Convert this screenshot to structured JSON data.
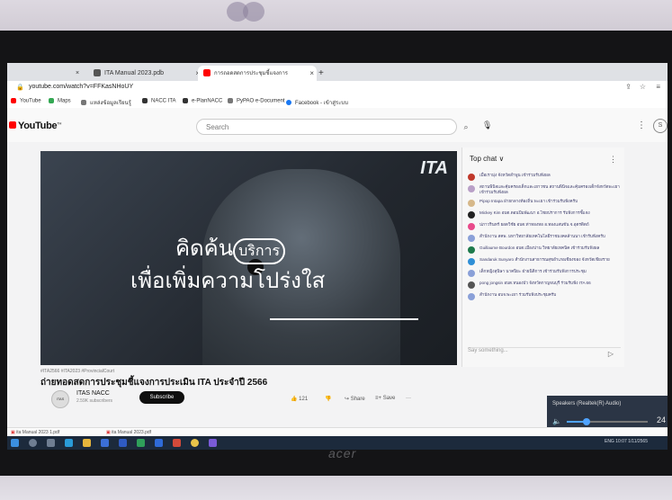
{
  "browser": {
    "tabs": [
      {
        "label": "×"
      },
      {
        "label": "ITA Manual 2023.pdb"
      },
      {
        "label": "การถอดสดการประชุมชี้แจงการ"
      }
    ],
    "new_tab": "+",
    "url": "youtube.com/watch?v=FFKasNHoUY",
    "bookmarks": [
      "YouTube",
      "Maps",
      "แหล่งข้อมูลเรียนรู้",
      "NACC ITA",
      "e-PlanNACC",
      "PyPAO e-Document",
      "Facebook - เข้าสู่ระบบ"
    ]
  },
  "youtube": {
    "logo": "YouTube",
    "logo_sup": "TH",
    "search_placeholder": "Search",
    "search_icon": "search-icon",
    "avatar_initial": "S"
  },
  "video": {
    "brand": "ITA",
    "overlay_line1": "คิดค้น",
    "overlay_bubble": "บริการ",
    "overlay_line2": "เพื่อเพิ่มความโปร่งใส"
  },
  "chat": {
    "header": "Top chat ∨",
    "menu": "⋮",
    "messages": [
      {
        "text": "เมื่อเรามุ่ง จังหวัดลำพูน เข้าร่วมรับฟังผล",
        "color": "#c0392b"
      },
      {
        "text": "สถานพินิจและคุ้มครองเด็กและเยาวชน สถานพินิจและคุ้มครองเด็กจังหวัดพะเยา เข้าร่วมรับฟังผล",
        "color": "#b9a0c7"
      },
      {
        "text": "Pipop Intapa ฝ่ายกลางท้องถิ่น พะเยา เข้าร่วมรับฟังครับ",
        "color": "#d6b88a"
      },
      {
        "text": "Mickey Kim อบต.ดอนปีมพัฒนา อ.ไชยปราการ รับฟังการชี้แจง",
        "color": "#222222"
      },
      {
        "text": "ปภาวรินทร์ ยอดวิชัย อบต.ท่าทองหอ อ.ทองแสนขัน จ.อุตรดิตถ์",
        "color": "#e84a8a"
      },
      {
        "text": "สำนักงาน สคพ. มหาวิทยาลัยเทคโนโลยีราชมงคลล้านนา เข้ารับฟังครับ",
        "color": "#8aa0d8"
      },
      {
        "text": "Guillaume Bourdon อบต.เมืองปาน วิทยาลัยเทคนิค เข้าร่วมรับฟังผล",
        "color": "#1e7a4c"
      },
      {
        "text": "Sandaruk Sunyaro สำนักงานสาธารณสุขอำเภอเชียงของ จังหวัดเชียงราย",
        "color": "#2f8fd6"
      },
      {
        "text": "เด็กหญิงสุนิษา นาคปิยะ ฝ่ายนิติการ เข้าร่วมรับฟังการประชุม",
        "color": "#8aa0d8"
      },
      {
        "text": "pong jongsin อบต.หนองบัว จังหวัดกาญจนบุรี ร่วมรับฟัง ITA 66",
        "color": "#555555"
      },
      {
        "text": "สำนักงาน อบจ.พะเยา ร่วมรับฟังประชุมครับ",
        "color": "#8aa0d8"
      }
    ],
    "input_placeholder": "Say something...",
    "send_icon": "send-icon"
  },
  "meta": {
    "hashtags": "#ITA2566 #ITA2023 #ProvincialCourt",
    "title": "ถ่ายทอดสดการประชุมชี้แจงการประเมิน ITA ประจำปี 2566",
    "channel": "ITAS NACC",
    "channel_avatar": "ITAS",
    "subscribers": "2.59K subscribers",
    "subscribe": "Subscribe",
    "likes": "121",
    "share": "Share",
    "save": "Save",
    "more": "···"
  },
  "audio_popup": {
    "title": "Speakers (Realtek(R) Audio)",
    "volume": 24,
    "volume_label": "24"
  },
  "downloads": [
    "ita Manual 2023 1.pdf",
    "ita Manual 2023.pdf"
  ],
  "tray": {
    "lang": "ENG",
    "time": "10:07",
    "date": "1/11/2565"
  },
  "monitor": {
    "brand": "acer"
  }
}
